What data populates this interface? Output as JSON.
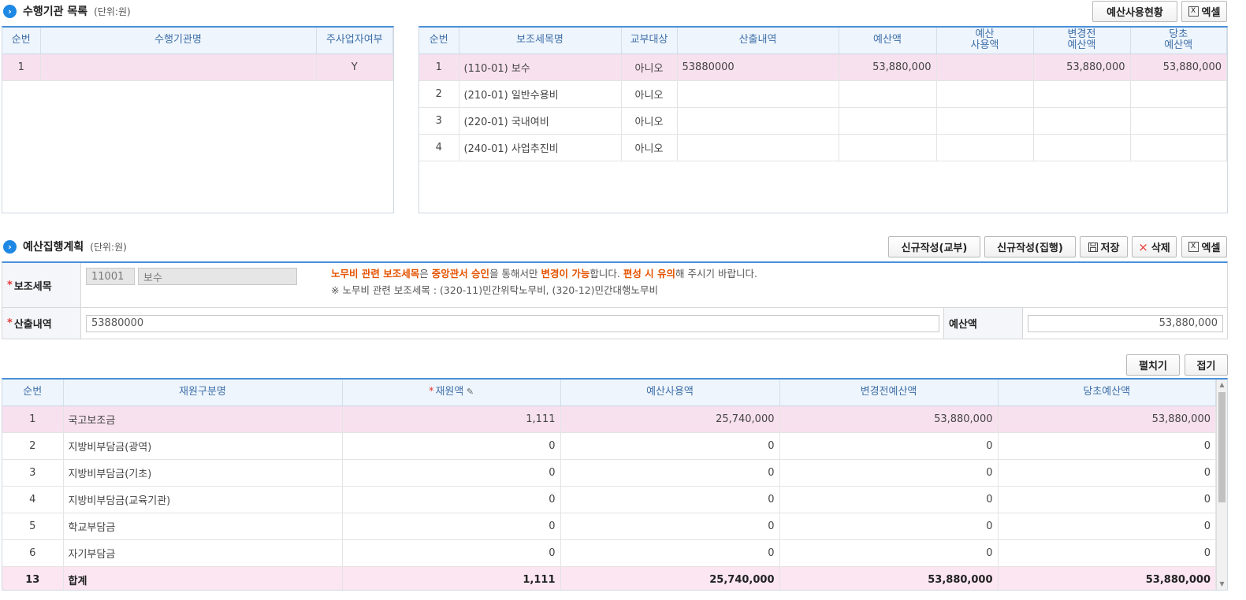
{
  "section1": {
    "title": "수행기관 목록",
    "unit": "(단위:원)"
  },
  "toolbar1": {
    "budget_status": "예산사용현황",
    "excel": "엑셀"
  },
  "org_table": {
    "headers": {
      "no": "순번",
      "name": "수행기관명",
      "main": "주사업자여부"
    },
    "rows": [
      {
        "no": "1",
        "name": "",
        "main": "Y"
      }
    ]
  },
  "sub_table": {
    "headers": {
      "no": "순번",
      "item": "보조세목명",
      "grant": "교부대상",
      "calc": "산출내역",
      "budget": "예산액",
      "used_l1": "예산",
      "used_l2": "사용액",
      "before_l1": "변경전",
      "before_l2": "예산액",
      "orig_l1": "당초",
      "orig_l2": "예산액"
    },
    "rows": [
      {
        "no": "1",
        "item": "(110-01) 보수",
        "grant": "아니오",
        "calc": "53880000",
        "budget": "53,880,000",
        "used": "",
        "before": "53,880,000",
        "orig": "53,880,000"
      },
      {
        "no": "2",
        "item": "(210-01) 일반수용비",
        "grant": "아니오",
        "calc": "",
        "budget": "",
        "used": "",
        "before": "",
        "orig": ""
      },
      {
        "no": "3",
        "item": "(220-01) 국내여비",
        "grant": "아니오",
        "calc": "",
        "budget": "",
        "used": "",
        "before": "",
        "orig": ""
      },
      {
        "no": "4",
        "item": "(240-01) 사업추진비",
        "grant": "아니오",
        "calc": "",
        "budget": "",
        "used": "",
        "before": "",
        "orig": ""
      }
    ]
  },
  "section2": {
    "title": "예산집행계획",
    "unit": "(단위:원)"
  },
  "toolbar2": {
    "new_grant": "신규작성(교부)",
    "new_exec": "신규작성(집행)",
    "save": "저장",
    "delete": "삭제",
    "excel": "엑셀"
  },
  "form": {
    "sub_item_label": "보조세목",
    "sub_item_code": "11001",
    "sub_item_name": "보수",
    "notice": {
      "p1": "노무비 관련 보조세목",
      "p2": "은 ",
      "p3": "중앙관서 승인",
      "p4": "을 통해서만 ",
      "p5": "변경이 가능",
      "p6": "합니다. ",
      "p7": "편성 시 유의",
      "p8": "해 주시기 바랍니다.",
      "line2": "※ 노무비 관련 보조세목 : (320-11)민간위탁노무비, (320-12)민간대행노무비"
    },
    "calc_label": "산출내역",
    "calc_value": "53880000",
    "budget_label": "예산액",
    "budget_value": "53,880,000"
  },
  "toolbar3": {
    "expand": "펼치기",
    "collapse": "접기"
  },
  "fund_table": {
    "headers": {
      "no": "순번",
      "type": "재원구분명",
      "amount": "재원액",
      "used": "예산사용액",
      "before": "변경전예산액",
      "orig": "당초예산액"
    },
    "rows": [
      {
        "no": "1",
        "type": "국고보조금",
        "amount": "1,111",
        "used": "25,740,000",
        "before": "53,880,000",
        "orig": "53,880,000"
      },
      {
        "no": "2",
        "type": "지방비부담금(광역)",
        "amount": "0",
        "used": "0",
        "before": "0",
        "orig": "0"
      },
      {
        "no": "3",
        "type": "지방비부담금(기초)",
        "amount": "0",
        "used": "0",
        "before": "0",
        "orig": "0"
      },
      {
        "no": "4",
        "type": "지방비부담금(교육기관)",
        "amount": "0",
        "used": "0",
        "before": "0",
        "orig": "0"
      },
      {
        "no": "5",
        "type": "학교부담금",
        "amount": "0",
        "used": "0",
        "before": "0",
        "orig": "0"
      },
      {
        "no": "6",
        "type": "자기부담금",
        "amount": "0",
        "used": "0",
        "before": "0",
        "orig": "0"
      }
    ],
    "total": {
      "no": "13",
      "type": "합계",
      "amount": "1,111",
      "used": "25,740,000",
      "before": "53,880,000",
      "orig": "53,880,000"
    }
  },
  "icons": {
    "section": "chevron-right-icon",
    "excel": "excel-icon",
    "save": "save-icon",
    "delete": "delete-icon",
    "edit": "edit-icon"
  }
}
